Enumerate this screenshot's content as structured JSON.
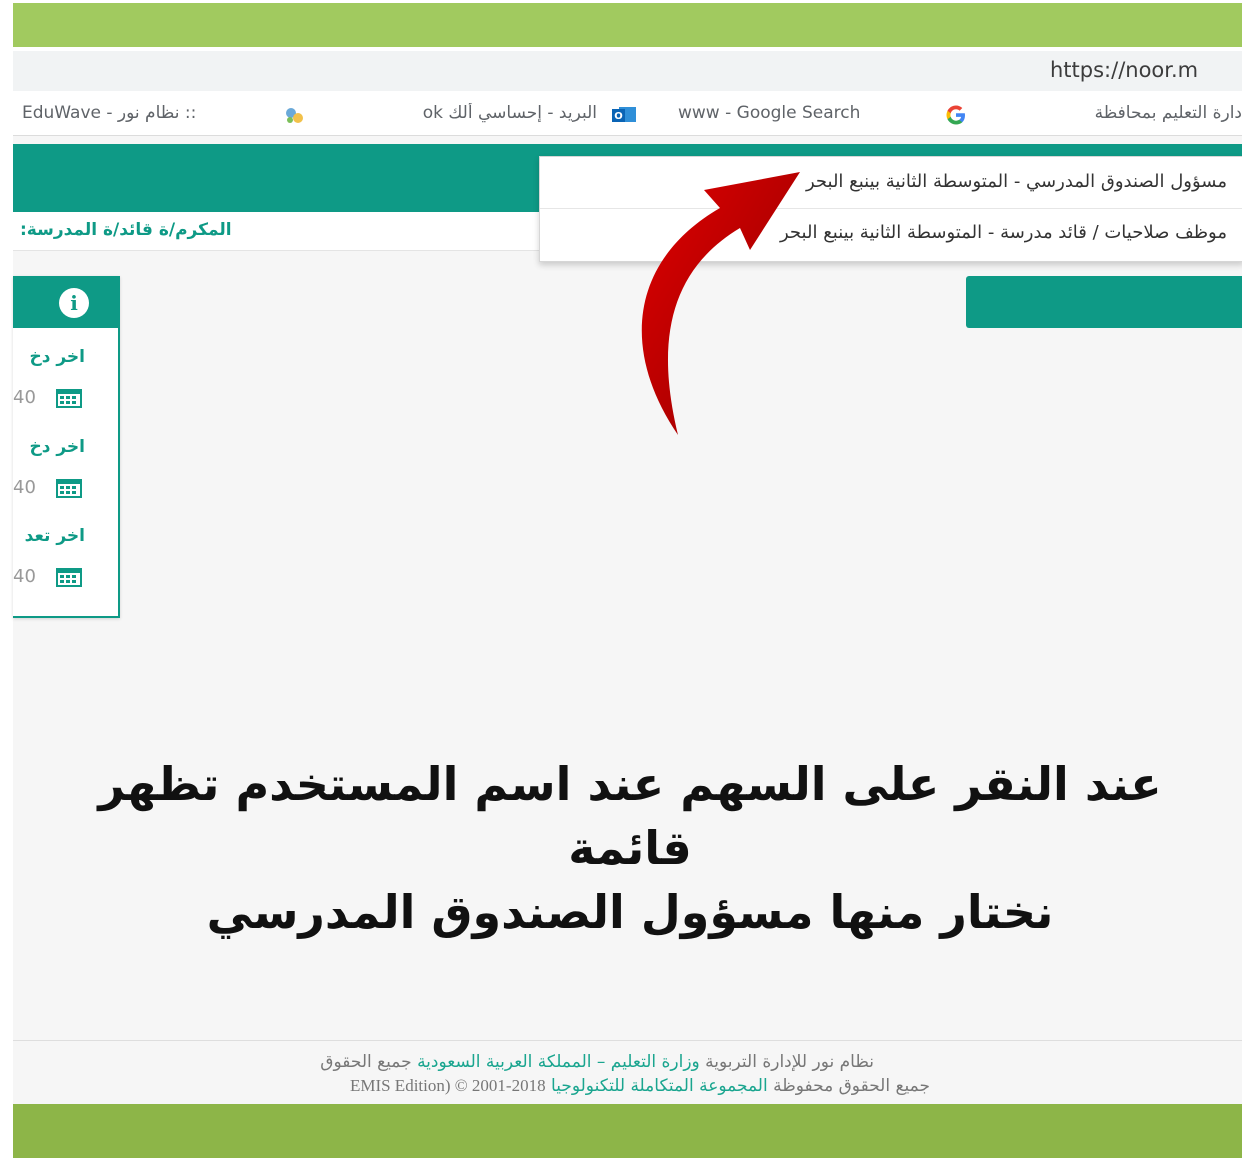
{
  "browser": {
    "url": "https://noor.m",
    "bookmarks": [
      {
        "label": "EduWave - نظام نور ::",
        "icon": "eduwave-icon"
      },
      {
        "label": "البريد - إحساسي ألك ok",
        "icon": "outlook-icon"
      },
      {
        "label": "www - Google Search",
        "icon": "google-icon"
      },
      {
        "label": "دارة التعليم بمحافظة",
        "icon": ""
      }
    ]
  },
  "header": {
    "greeting": "المكرم/ة قائد/ة المدرسة:"
  },
  "role_menu": {
    "items": [
      "مسؤول الصندوق المدرسي - المتوسطة الثانية بينبع البحر",
      "موظف صلاحيات / قائد مدرسة - المتوسطة الثانية بينبع البحر"
    ]
  },
  "info_panel": {
    "entries": [
      {
        "label": "اخر دخ",
        "value": "40"
      },
      {
        "label": "اخر دخ",
        "value": "40"
      },
      {
        "label": "اخر تعد",
        "value": "40"
      }
    ]
  },
  "instruction": {
    "line1": "عند النقر على السهم عند اسم المستخدم تظهر قائمة",
    "line2": "نختار منها مسؤول الصندوق المدرسي"
  },
  "footer": {
    "line1_a": "نظام نور للإدارة التربوية",
    "line1_b": "وزارة التعليم – المملكة العربية السعودية",
    "line1_c": "جميع الحقوق",
    "line2_a": "جميع الحقوق محفوظة",
    "line2_b": "المجموعة المتكاملة للتكنولوجيا",
    "line2_c": "EMIS Edition) © 2001-2018"
  },
  "colors": {
    "teal": "#0e9a86",
    "green_band": "#a1ca5f",
    "arrow_red": "#c40000"
  }
}
